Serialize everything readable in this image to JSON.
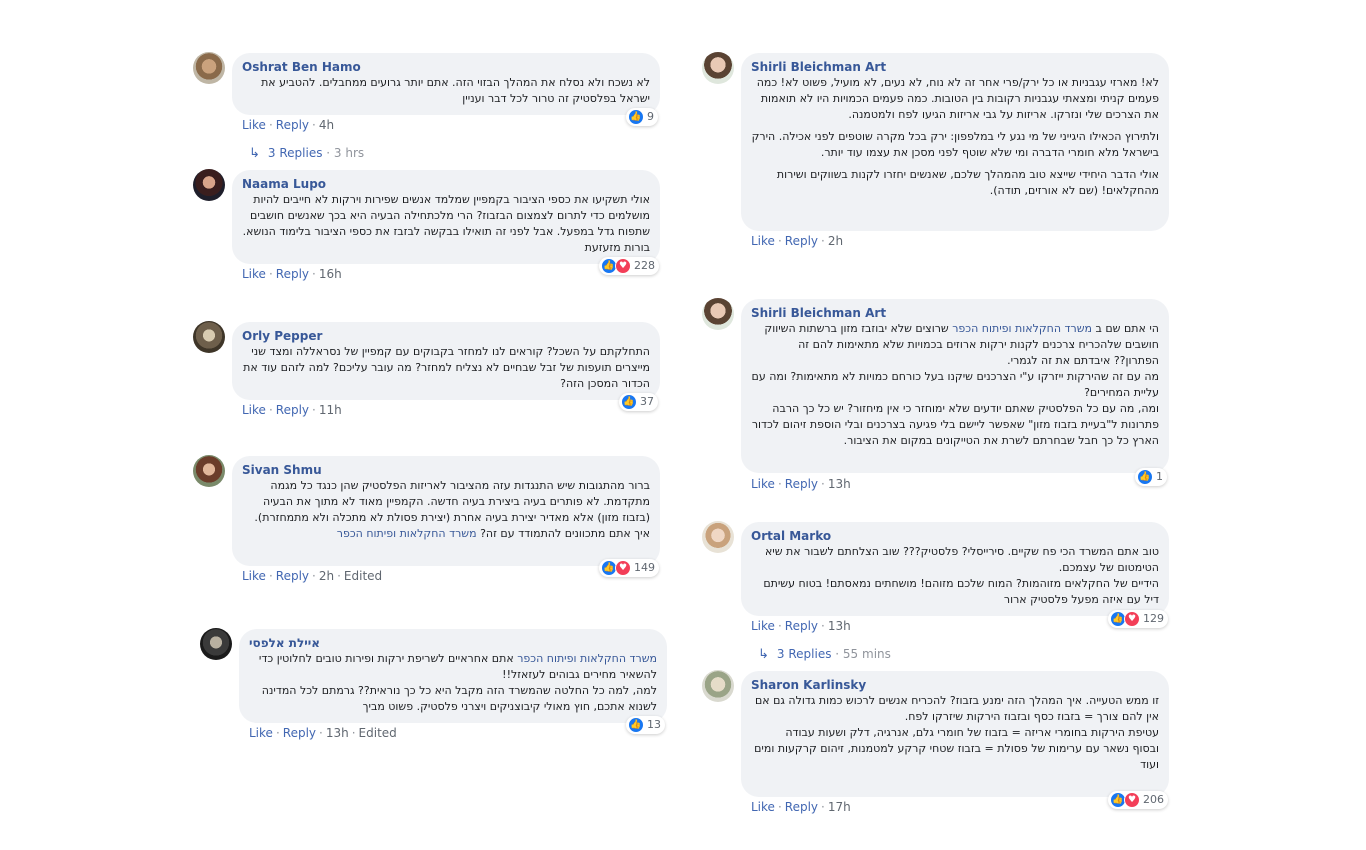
{
  "labels": {
    "like": "Like",
    "reply": "Reply",
    "edited": "Edited"
  },
  "threads": [
    {
      "author": "Shirli Bleichman Art",
      "paragraphs": [
        "לא! מארזי עגבניות או כל ירק/פרי אחר זה לא נוח, לא נעים, לא מועיל, פשוט לא! כמה פעמים קניתי ומצאתי עגבניות רקובות בין הטובות. כמה פעמים הכמויות היו לא תואמות את הצרכים שלי ונזרקו. אריזות על גבי אריזות הגיעו לפח ולמטמנה.",
        "ולתירוץ הכאילו היגייני של מי נגע לי במלפפון: ירק בכל מקרה שוטפים לפני אכילה. הירק בישראל מלא חומרי הדברה ומי שלא שוטף לפני מסכן את עצמו עוד יותר.",
        "אולי הדבר היחידי שייצא טוב מהמהלך שלכם, שאנשים יחזרו לקנות בשווקים ושירות מהחקלאים! (שם לא אורזים, תודה)."
      ],
      "time": "2h"
    },
    {
      "author": "Shirli Bleichman Art",
      "mention": "משרד החקלאות ופיתוח הכפר",
      "paragraphs": [
        "הי אתם שם ב משרד החקלאות ופיתוח הכפר שרוצים שלא יבוזבז מזון ברשתות השיווק חושבים שלהכריח צרכנים לקנות ירקות ארוזים בכמויות שלא מתאימות להם זה הפתרון?? איבדתם את זה לגמרי.",
        "מה עם זה שהירקות ייזרקו ע\"י הצרכנים שיקנו בעל כורחם כמויות לא מתאימות? ומה עם עליית המחירים?",
        "ומה, מה עם כל הפלסטיק שאתם יודעים שלא ימוחזר כי אין מיחזור? יש כל כך הרבה פתרונות ל\"בעיית בזבוז מזון\" שאפשר ליישם בלי פגיעה בצרכנים ובלי הוספת זיהום לכדור הארץ כל כך חבל שבחרתם לשרת את הטייקונים במקום את הציבור."
      ],
      "time": "13h",
      "reactions": "1"
    },
    {
      "author": "Ortal Marko",
      "paragraphs": [
        "טוב אתם המשרד הכי פח שקיים. סירייסלי? פלסטיק??? שוב הצלחתם לשבור את שיא הטימטום של עצמכם.",
        "הידיים של החקלאים מזוהמות? המוח שלכם מזוהם! מושחתים נמאסתם! בטוח עשיתם דיל עם איזה מפעל פלסטיק ארור"
      ],
      "time": "13h",
      "reactions": "129",
      "replies": "3 Replies",
      "replies_time": "55 mins"
    },
    {
      "author": "Sharon Karlinsky",
      "paragraphs": [
        "זו ממש הטעייה. איך המהלך הזה ימנע בזבוז? להכריח אנשים לרכוש כמות גדולה גם אם אין להם צורך = בזבוז כסף ובזבוז הירקות שיזרקו לפח.",
        "עטיפת הירקות בחומרי אריזה = בזבוז של חומרי גלם, אנרגיה, דלק ושעות עבודה",
        "ובסוף נשאר עם ערימות של פסולת = בזבוז שטחי קרקע למטמנות, זיהום קרקעות ומים ועוד"
      ],
      "time": "17h",
      "reactions": "206"
    },
    {
      "author": "Oshrat Ben Hamo",
      "paragraphs": [
        "לא נשכח ולא נסלח את המהלך הבזוי הזה. אתם יותר גרועים ממחבלים. להטביע את ישראל בפלסטיק זה טרור לכל דבר ועניין"
      ],
      "time": "4h",
      "reactions": "9",
      "replies": "3 Replies",
      "replies_time": "3 hrs"
    },
    {
      "author": "Naama Lupo",
      "paragraphs": [
        "אולי תשקיעו את כספי הציבור בקמפיין שמלמד אנשים שפירות וירקות לא חייבים להיות מושלמים כדי לתרום לצמצום הבזבוז? הרי מלכתחילה הבעיה היא בכך שאנשים חושבים שתפוח גדל במפעל. אבל לפני זה תואילו בבקשה לבזבז את כספי הציבור בלימוד הנושא. בורות מזעזעת"
      ],
      "time": "16h",
      "reactions": "228"
    },
    {
      "author": "Orly Pepper",
      "paragraphs": [
        "התחלקתם על השכל? קוראים לנו למחזר בקבוקים עם קמפיין של נסראללה ומצד שני מייצרים תועפות של זבל שבחיים לא נצליח למחזר? מה עובר עליכם? למה לזהם עוד את הכדור המסכן הזה?"
      ],
      "time": "11h",
      "reactions": "37"
    },
    {
      "author": "Sivan Shmu",
      "mention": "משרד החקלאות ופיתוח הכפר",
      "paragraphs": [
        "ברור מהתגובות שיש התנגדות עזה מהציבור לאריזות הפלסטיק שהן כנגד כל מגמה מתקדמת. לא פותרים בעיה ביצירת בעיה חדשה. הקמפיין מאוד לא מתוך את הבעיה (בזבוז מזון) אלא מאדיר יצירת בעיה אחרת (יצירת פסולת לא מתכלה ולא מתמחזרת). איך אתם מתכוונים להתמודד עם זה? משרד החקלאות ופיתוח הכפר"
      ],
      "time": "2h",
      "reactions": "149"
    },
    {
      "author": "איילת אלפסי",
      "mention": "משרד החקלאות ופיתוח הכפר",
      "paragraphs": [
        "משרד החקלאות ופיתוח הכפר אתם אחראיים לשריפת ירקות ופירות טובים לחלוטין כדי להשאיר מחירים גבוהים לעזאזל!!",
        "למה, למה כל החלטה שהמשרד הזה מקבל היא כל כך נוראית?? גרמתם לכל המדינה לשנוא אתכם, חוץ מאולי קיבוצניקים ויצרני פלסטיק. פשוט מביך"
      ],
      "time": "13h",
      "reactions": "13"
    }
  ],
  "colors": {
    "link": "#385898",
    "bubble": "#f0f2f5",
    "like": "#1877f2",
    "love": "#f33e58",
    "muted": "#606770"
  }
}
